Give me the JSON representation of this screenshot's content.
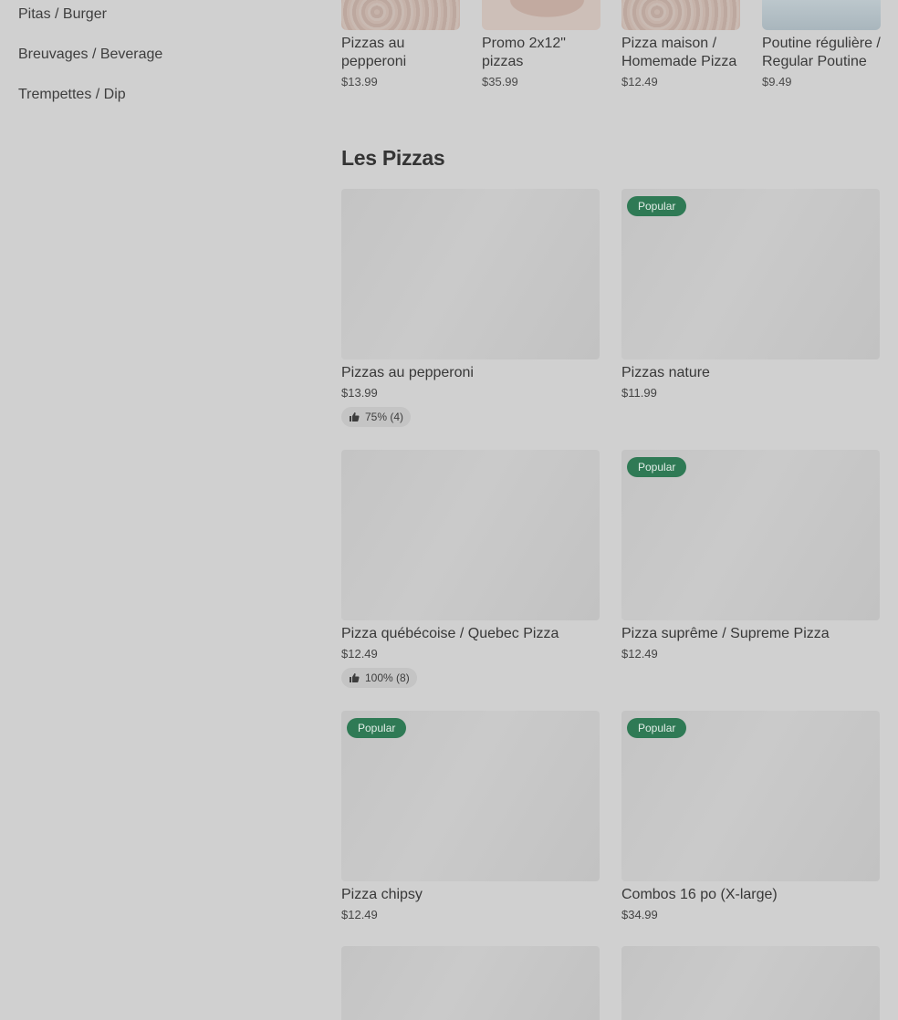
{
  "sidebar": {
    "items": [
      {
        "label": "Pitas / Burger"
      },
      {
        "label": "Breuvages / Beverage"
      },
      {
        "label": "Trempettes / Dip"
      }
    ]
  },
  "carousel": {
    "items": [
      {
        "name": "Pizzas au pepperoni",
        "price": "$13.99"
      },
      {
        "name": "Promo 2x12\" pizzas",
        "price": "$35.99"
      },
      {
        "name": "Pizza maison / Homemade Pizza",
        "price": "$12.49"
      },
      {
        "name": "Poutine régulière / Regular Poutine",
        "price": "$9.49"
      }
    ]
  },
  "section": {
    "title": "Les Pizzas",
    "items": [
      {
        "name": "Pizzas au pepperoni",
        "price": "$13.99",
        "badge": "",
        "rating": "75% (4)"
      },
      {
        "name": "Pizzas nature",
        "price": "$11.99",
        "badge": "Popular",
        "rating": ""
      },
      {
        "name": "Pizza québécoise / Quebec Pizza",
        "price": "$12.49",
        "badge": "",
        "rating": "100% (8)"
      },
      {
        "name": "Pizza suprême / Supreme Pizza",
        "price": "$12.49",
        "badge": "Popular",
        "rating": ""
      },
      {
        "name": "Pizza chipsy",
        "price": "$12.49",
        "badge": "Popular",
        "rating": ""
      },
      {
        "name": "Combos 16 po (X-large)",
        "price": "$34.99",
        "badge": "Popular",
        "rating": ""
      }
    ]
  },
  "colors": {
    "badge": "#2f7a55",
    "overlay": "#d0d0d0"
  },
  "icons": {
    "rating": "thumbs-up-icon"
  }
}
